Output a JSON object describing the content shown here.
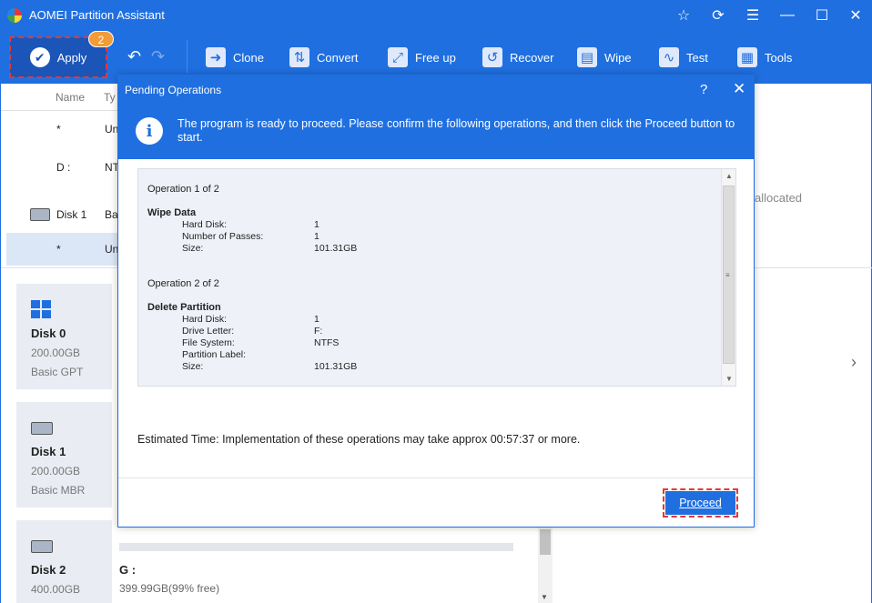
{
  "window": {
    "title": "AOMEI Partition Assistant"
  },
  "toolbar": {
    "apply_label": "Apply",
    "apply_badge": "2",
    "tools": [
      {
        "label": "Clone",
        "icon": "clone-icon"
      },
      {
        "label": "Convert",
        "icon": "convert-icon"
      },
      {
        "label": "Free up",
        "icon": "free-up-icon"
      },
      {
        "label": "Recover",
        "icon": "recover-icon"
      },
      {
        "label": "Wipe",
        "icon": "wipe-icon"
      },
      {
        "label": "Test",
        "icon": "test-icon"
      },
      {
        "label": "Tools",
        "icon": "tools-icon"
      }
    ]
  },
  "list": {
    "col_name": "Name",
    "col_type": "Ty",
    "rows": [
      {
        "name": "*",
        "type": "Un"
      },
      {
        "name": "D :",
        "type": "NT"
      },
      {
        "name": "Disk 1",
        "type": "Ba"
      },
      {
        "name": "*",
        "type": "Un"
      }
    ]
  },
  "disks": [
    {
      "name": "Disk 0",
      "size": "200.00GB",
      "type": "Basic GPT"
    },
    {
      "name": "Disk 1",
      "size": "200.00GB",
      "type": "Basic MBR"
    },
    {
      "name": "Disk 2",
      "size": "400.00GB"
    }
  ],
  "partition_g": {
    "label": "G :",
    "free": "399.99GB(99% free)"
  },
  "right_panel": {
    "text": "allocated"
  },
  "dialog": {
    "title": "Pending Operations",
    "message": "The program is ready to proceed. Please confirm the following operations, and then click the Proceed button to start.",
    "operations": [
      {
        "count": "Operation 1 of 2",
        "name": "Wipe Data",
        "fields": [
          {
            "k": "Hard Disk:",
            "v": "1"
          },
          {
            "k": "Number of Passes:",
            "v": "1"
          },
          {
            "k": "Size:",
            "v": "101.31GB"
          }
        ]
      },
      {
        "count": "Operation 2 of 2",
        "name": "Delete Partition",
        "fields": [
          {
            "k": "Hard Disk:",
            "v": "1"
          },
          {
            "k": "Drive Letter:",
            "v": "F:"
          },
          {
            "k": "File System:",
            "v": "NTFS"
          },
          {
            "k": "Partition Label:",
            "v": ""
          },
          {
            "k": "Size:",
            "v": "101.31GB"
          }
        ]
      }
    ],
    "estimated_time": "Estimated Time: Implementation of these operations may take approx 00:57:37 or more.",
    "proceed_label": "Proceed"
  }
}
